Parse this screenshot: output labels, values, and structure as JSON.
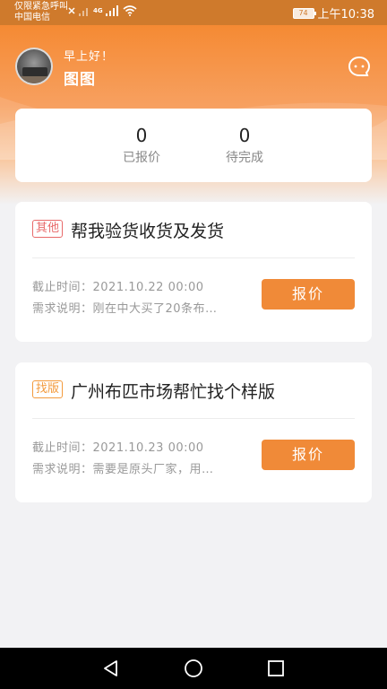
{
  "status_bar": {
    "carrier_line1": "仅限紧急呼叫",
    "carrier_line2": "中国电信",
    "network": "4G",
    "battery": "74",
    "time": "上午10:38"
  },
  "header": {
    "greeting": "早上好！",
    "username": "图图",
    "chat_icon": "chat-bubble-icon"
  },
  "stats": [
    {
      "value": "0",
      "label": "已报价"
    },
    {
      "value": "0",
      "label": "待完成"
    }
  ],
  "orders": [
    {
      "tag": "其他",
      "title": "帮我验货收货及发货",
      "deadline_label": "截止时间：",
      "deadline": "2021.10.22 00:00",
      "desc_label": "需求说明：",
      "desc": "刚在中大买了20条布…",
      "button": "报价"
    },
    {
      "tag": "找版",
      "title": "广州布匹市场帮忙找个样版",
      "deadline_label": "截止时间：",
      "deadline": "2021.10.23 00:00",
      "desc_label": "需求说明：",
      "desc": "需要是原头厂家，用…",
      "button": "报价"
    }
  ],
  "nav": {
    "back_icon": "back-triangle-icon",
    "home_icon": "home-circle-icon",
    "recents_icon": "recents-square-icon"
  },
  "colors": {
    "accent": "#f08a38",
    "tag_other": "#e86a6a",
    "tag_find": "#f39a3c"
  }
}
